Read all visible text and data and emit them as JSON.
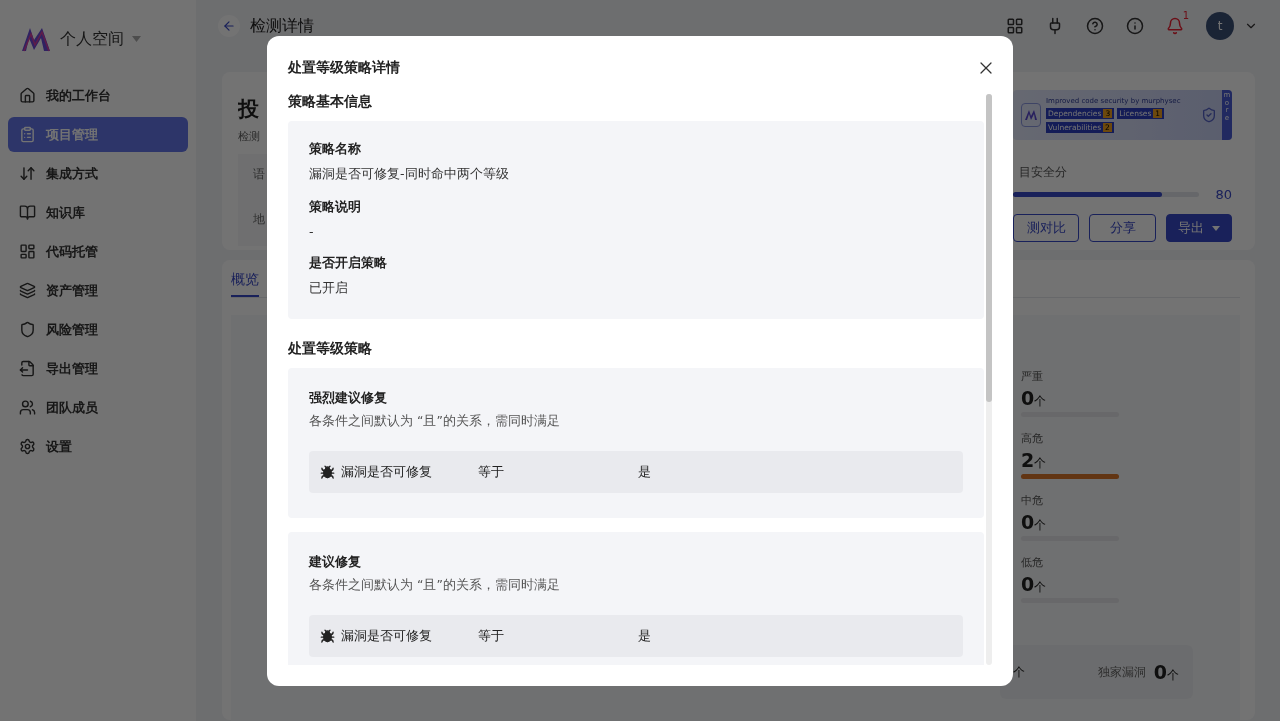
{
  "sidebar": {
    "workspace": "个人空间",
    "items": [
      {
        "label": "我的工作台",
        "selected": false
      },
      {
        "label": "项目管理",
        "selected": true
      },
      {
        "label": "集成方式",
        "selected": false
      },
      {
        "label": "知识库",
        "selected": false
      },
      {
        "label": "代码托管",
        "selected": false
      },
      {
        "label": "资产管理",
        "selected": false
      },
      {
        "label": "风险管理",
        "selected": false
      },
      {
        "label": "导出管理",
        "selected": false
      },
      {
        "label": "团队成员",
        "selected": false
      },
      {
        "label": "设置",
        "selected": false
      }
    ]
  },
  "header": {
    "title": "检测详情",
    "notification_count": "1",
    "avatar": "t"
  },
  "project": {
    "title": "投",
    "meta": "检测",
    "fields": [
      "语",
      "地"
    ],
    "banner": {
      "text": "Improved code security by murphysec",
      "badges": [
        {
          "label": "Dependencies",
          "count": "3"
        },
        {
          "label": "Licenses",
          "count": "1"
        },
        {
          "label": "Vulnerabilities",
          "count": "2"
        }
      ],
      "more": "more"
    },
    "score": {
      "label": "目安全分",
      "level": 0.8,
      "value": "80"
    },
    "buttons": [
      {
        "label": "测对比",
        "kind": "outline"
      },
      {
        "label": "分享",
        "kind": "outline"
      },
      {
        "label": "导出",
        "kind": "primary"
      }
    ]
  },
  "tabs": [
    {
      "label": "概览",
      "selected": true
    }
  ],
  "severity": [
    {
      "label": "严重",
      "count": "0",
      "unit": "个"
    },
    {
      "label": "高危",
      "count": "2",
      "unit": "个",
      "level": 1
    },
    {
      "label": "中危",
      "count": "0",
      "unit": "个"
    },
    {
      "label": "低危",
      "count": "0",
      "unit": "个"
    }
  ],
  "stats": {
    "partial_unit": "个",
    "exclusive": {
      "label": "独家漏洞",
      "count": "0",
      "unit": "个"
    }
  },
  "modal": {
    "title": "处置等级策略详情",
    "sections": [
      {
        "title": "策略基本信息",
        "kind": "info",
        "fields": [
          {
            "label": "策略名称",
            "value": "漏洞是否可修复-同时命中两个等级"
          },
          {
            "label": "策略说明",
            "value": "-"
          },
          {
            "label": "是否开启策略",
            "value": "已开启"
          }
        ]
      },
      {
        "title": "处置等级策略",
        "kind": "levels",
        "levels": [
          {
            "name": "强烈建议修复",
            "note": "各条件之间默认为 “且”的关系，需同时满足",
            "conditions": [
              {
                "field": "漏洞是否可修复",
                "operator": "等于",
                "value": "是"
              }
            ]
          },
          {
            "name": "建议修复",
            "note": "各条件之间默认为 “且”的关系，需同时满足",
            "conditions": [
              {
                "field": "漏洞是否可修复",
                "operator": "等于",
                "value": "是"
              }
            ]
          }
        ]
      }
    ]
  }
}
